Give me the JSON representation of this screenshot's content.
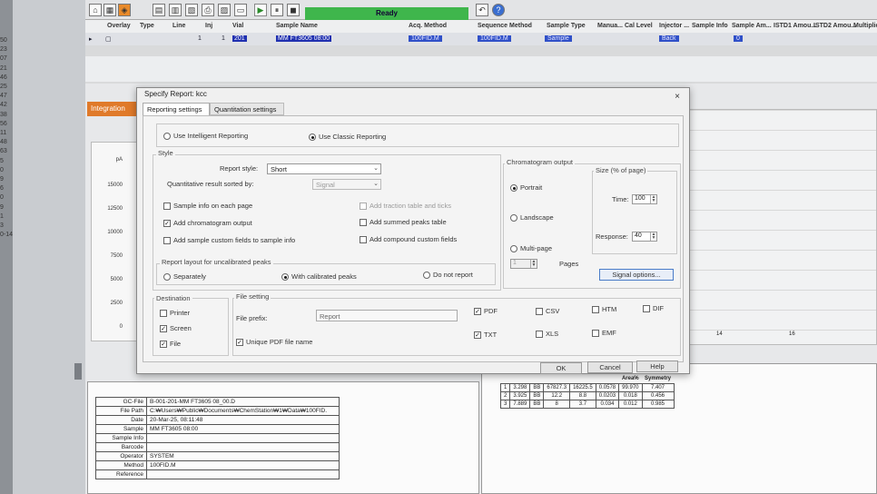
{
  "row_numbers": [
    "50",
    "23",
    "07",
    "21",
    "46",
    "25",
    "47",
    "42",
    "38",
    "56",
    "11",
    "48",
    "63",
    "5",
    "0",
    "9",
    "6",
    "0",
    "9",
    "1",
    "3",
    "0-14"
  ],
  "toolbar": {
    "status": "Ready",
    "seq_headers": [
      "Overlay",
      "Type",
      "Line",
      "Inj",
      "Vial",
      "Sample Name",
      "Acq. Method",
      "Sequence Method",
      "Sample Type",
      "Manua...",
      "Cal Level",
      "Injector ...",
      "Sample Info",
      "Sample Am...",
      "ISTD1 Amou...",
      "ISTD2 Amou...",
      "Multiplier"
    ],
    "seq_row": {
      "line": "1",
      "inj": "1",
      "vial": "201",
      "sample_name": "MM FT3605 08:00",
      "acq_method": "100FID.M",
      "seq_method": "100FID.M",
      "sample_type": "Sample",
      "injector": "Back",
      "sample_amount": "0"
    }
  },
  "integration_tab": "Integration",
  "chart_axis": {
    "unit": "pA",
    "ticks": [
      "15000",
      "12500",
      "10000",
      "7500",
      "5000",
      "2500",
      "0"
    ]
  },
  "right_axis_ticks": [
    "14",
    "16"
  ],
  "dialog": {
    "title": "Specify Report: kcc",
    "close": "×",
    "tabs": [
      "Reporting settings",
      "Quantitation settings"
    ],
    "mode": {
      "intelligent": "Use Intelligent Reporting",
      "classic": "Use Classic Reporting",
      "selected": "classic"
    },
    "style": {
      "label": "Style",
      "report_style_label": "Report style:",
      "report_style_value": "Short",
      "sorted_by_label": "Quantitative result sorted by:",
      "sorted_by_value": "Signal",
      "checks": [
        {
          "label": "Sample info on each page",
          "checked": false,
          "enabled": true
        },
        {
          "label": "Add chromatogram output",
          "checked": true,
          "enabled": true
        },
        {
          "label": "Add sample custom fields to sample info",
          "checked": false,
          "enabled": true
        },
        {
          "label": "Add traction table and ticks",
          "checked": false,
          "enabled": false
        },
        {
          "label": "Add summed peaks table",
          "checked": false,
          "enabled": true
        },
        {
          "label": "Add compound custom fields",
          "checked": false,
          "enabled": true
        }
      ],
      "uncal_label": "Report layout for uncalibrated peaks",
      "uncal_options": [
        "Separately",
        "With calibrated peaks",
        "Do not report"
      ],
      "uncal_selected": 1
    },
    "chromatogram": {
      "label": "Chromatogram output",
      "orientation": [
        "Portrait",
        "Landscape",
        "Multi-page"
      ],
      "selected": 0,
      "pages_label": "Pages",
      "pages_value": "1",
      "size_label": "Size (% of page)",
      "time_label": "Time:",
      "time_value": "100",
      "response_label": "Response:",
      "response_value": "40",
      "signal_options": "Signal options..."
    },
    "destination": {
      "label": "Destination",
      "items": [
        {
          "label": "Printer",
          "checked": false
        },
        {
          "label": "Screen",
          "checked": true
        },
        {
          "label": "File",
          "checked": true
        }
      ]
    },
    "file_setting": {
      "label": "File setting",
      "prefix_label": "File prefix:",
      "prefix_value": "Report",
      "unique_pdf": "Unique PDF file name",
      "formats": [
        {
          "label": "PDF",
          "checked": true
        },
        {
          "label": "CSV",
          "checked": false
        },
        {
          "label": "HTM",
          "checked": false
        },
        {
          "label": "DIF",
          "checked": false
        },
        {
          "label": "TXT",
          "checked": true
        },
        {
          "label": "XLS",
          "checked": false
        },
        {
          "label": "EMF",
          "checked": false
        }
      ]
    },
    "buttons": {
      "ok": "OK",
      "cancel": "Cancel",
      "help": "Help"
    }
  },
  "sample_info": [
    {
      "key": "GC-File",
      "value": "B-001-201-MM FT3605 08_00.D"
    },
    {
      "key": "File Path",
      "value": "C:₩Users₩Public₩Documents₩ChemStation₩1₩Data₩100FID."
    },
    {
      "key": "Date",
      "value": "20-Mar-25, 08:11:48"
    },
    {
      "key": "Sample",
      "value": "MM FT3605 08:00"
    },
    {
      "key": "Sample Info",
      "value": ""
    },
    {
      "key": "Barcode",
      "value": ""
    },
    {
      "key": "Operator",
      "value": "SYSTEM"
    },
    {
      "key": "Method",
      "value": "100FID.M"
    },
    {
      "key": "Reference",
      "value": ""
    }
  ],
  "peak_table": {
    "headers": [
      "Area%",
      "Symmetry"
    ],
    "rows": [
      [
        "1",
        "3.298",
        "BB",
        "67827.3",
        "16225.5",
        "0.0578",
        "99.970",
        "7.407"
      ],
      [
        "2",
        "3.925",
        "BB",
        "12.2",
        "8.8",
        "0.0203",
        "0.018",
        "0.456"
      ],
      [
        "3",
        "7.889",
        "BB",
        "8",
        "3.7",
        "0.034",
        "0.012",
        "0.985"
      ]
    ]
  }
}
